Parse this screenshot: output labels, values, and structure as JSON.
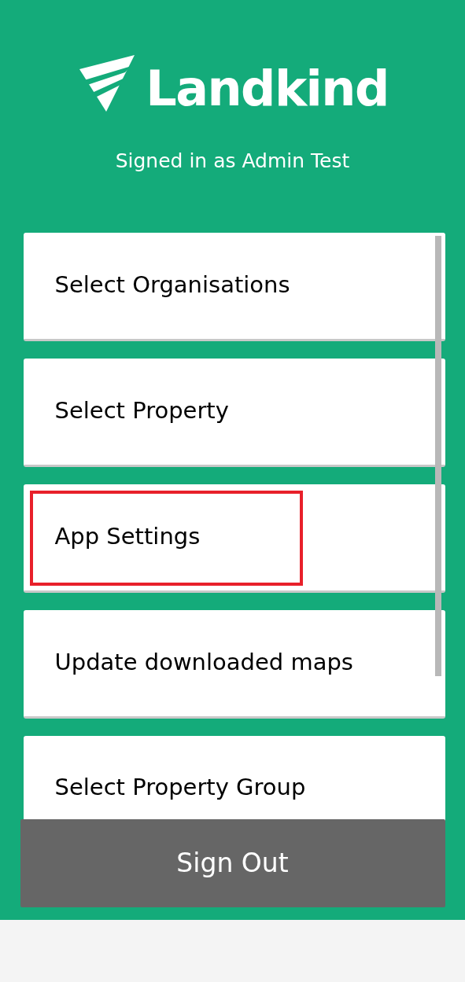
{
  "brand": {
    "name": "Landkind"
  },
  "signed_in": "Signed in as Admin Test",
  "menu": [
    {
      "label": "Select Organisations",
      "highlighted": false
    },
    {
      "label": "Select Property",
      "highlighted": false
    },
    {
      "label": "App Settings",
      "highlighted": true
    },
    {
      "label": "Update downloaded maps",
      "highlighted": false
    },
    {
      "label": "Select Property Group",
      "highlighted": false
    }
  ],
  "sign_out": "Sign Out"
}
